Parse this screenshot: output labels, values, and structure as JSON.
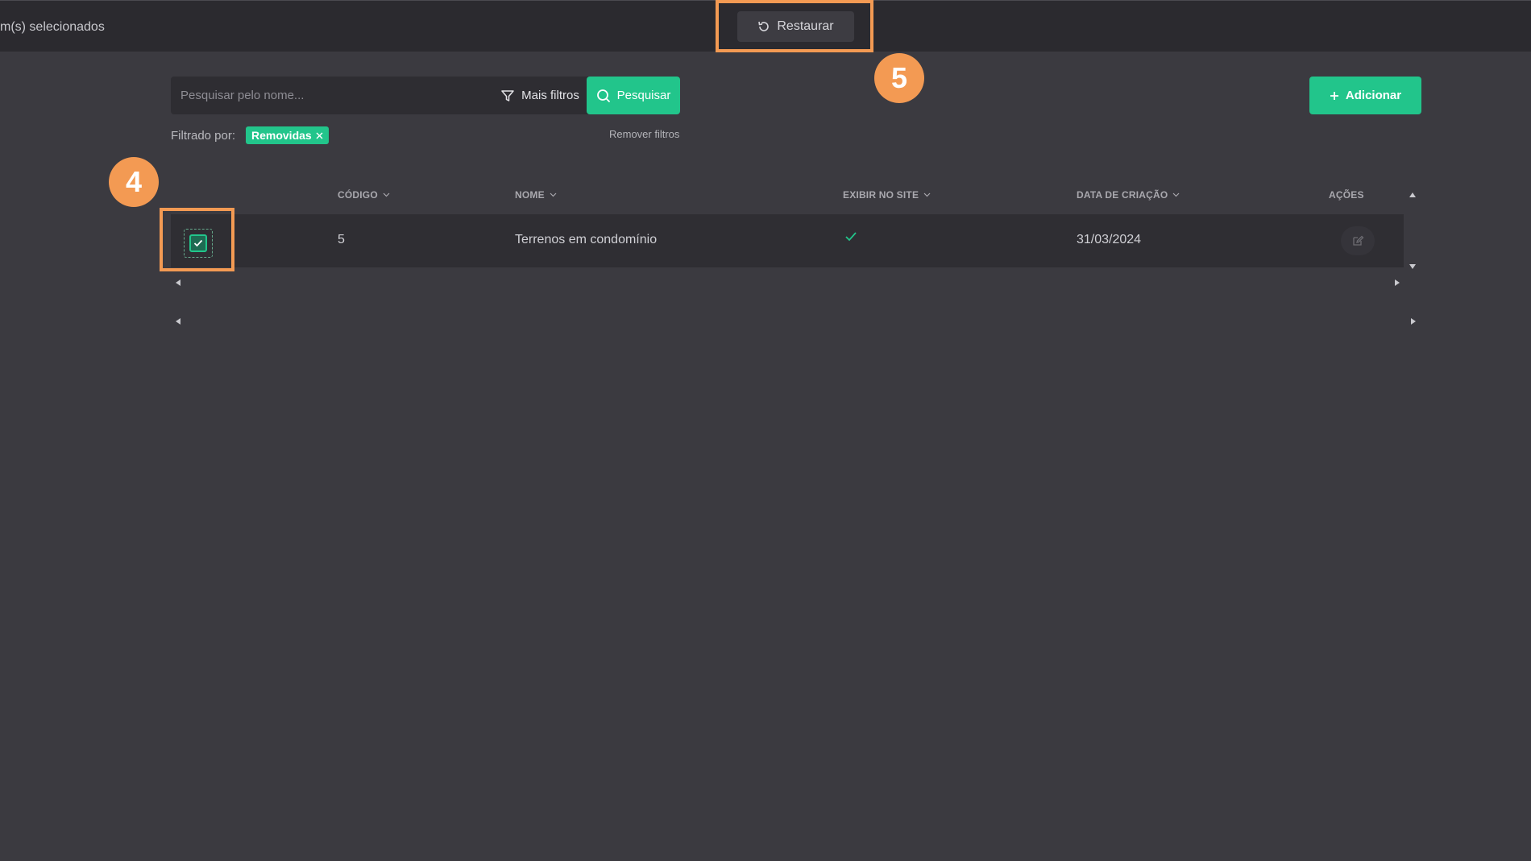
{
  "topbar": {
    "selected_text": "m(s) selecionados",
    "restore_label": "Restaurar"
  },
  "annotations": {
    "step_checkbox": "4",
    "step_restore": "5",
    "highlight_color": "#f39a53"
  },
  "search": {
    "placeholder": "Pesquisar pelo nome...",
    "value": "",
    "more_filters_label": "Mais filtros",
    "search_label": "Pesquisar"
  },
  "add_button": {
    "label": "Adicionar",
    "icon": "plus-icon"
  },
  "filters": {
    "label": "Filtrado por:",
    "chips": [
      "Removidas"
    ],
    "remove_label": "Remover filtros"
  },
  "table": {
    "columns": [
      "CÓDIGO",
      "NOME",
      "EXIBIR NO SITE",
      "DATA DE CRIAÇÃO",
      "AÇÕES"
    ],
    "rows": [
      {
        "selected": true,
        "codigo": "5",
        "nome": "Terrenos em condomínio",
        "exibir_no_site": true,
        "data_criacao": "31/03/2024"
      }
    ]
  },
  "colors": {
    "accent": "#22c58b",
    "background": "#3b3a40",
    "topbar": "#2b2a2f",
    "row": "#2f2e33"
  }
}
